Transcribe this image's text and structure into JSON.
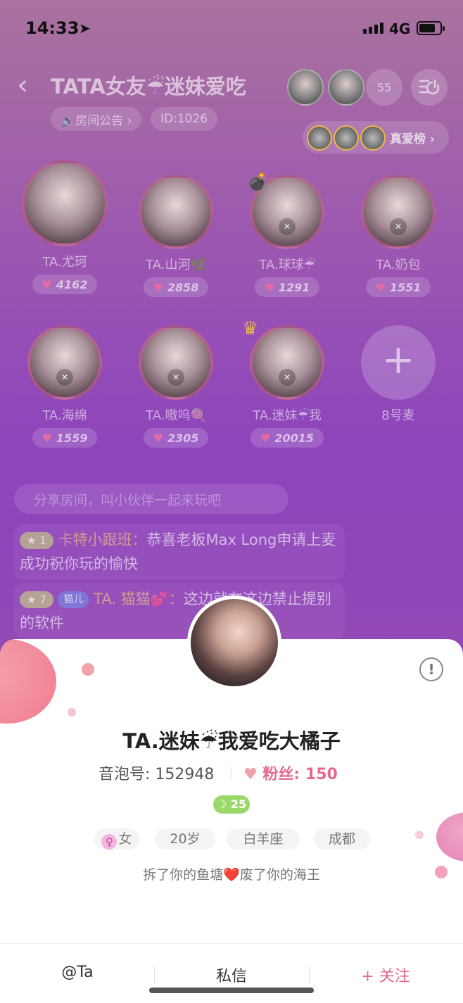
{
  "status_bar": {
    "time": "14:33",
    "network": "4G"
  },
  "header": {
    "title": "TATA女友☔迷妹爱吃",
    "online_count": "55",
    "announcement": "🔈房间公告 ›",
    "room_id": "ID:1026",
    "rank_label": "真爱榜 ›"
  },
  "seats": [
    {
      "name": "TA.尤珂",
      "count": "4162"
    },
    {
      "name": "TA.山河🌿",
      "count": "2858"
    },
    {
      "name": "TA.球球☔",
      "count": "1291"
    },
    {
      "name": "TA.奶包",
      "count": "1551"
    },
    {
      "name": "TA.海绵",
      "count": "1559"
    },
    {
      "name": "TA.嗷呜🍭",
      "count": "2305"
    },
    {
      "name": "TA.迷妹☔我",
      "count": "20015"
    },
    {
      "name": "8号麦"
    }
  ],
  "chat": {
    "share_hint": "分享房间，叫小伙伴一起来玩吧",
    "messages": [
      {
        "level": "★ 1",
        "sender": "卡特小跟班：",
        "text": "恭喜老板Max Long申请上麦成功祝你玩的愉快"
      },
      {
        "level": "★ 7",
        "tag": "猫儿",
        "sender": "TA. 猫猫💕：",
        "text": "这边就在这边禁止提别的软件"
      }
    ]
  },
  "profile": {
    "nickname": "TA.迷妹☔我爱吃大橘子",
    "uid": "音泡号: 152948",
    "fans_label": "粉丝:",
    "fans": "150",
    "level": "☽ 25",
    "gender": "女",
    "age": "20岁",
    "zodiac": "白羊座",
    "city": "成都",
    "bio": "拆了你的鱼塘❤️废了你的海王"
  },
  "actions": {
    "at": "@Ta",
    "message": "私信",
    "follow": "+ 关注"
  },
  "colors": {
    "accent": "#e26a90",
    "level_badge": "#9ad86a"
  }
}
